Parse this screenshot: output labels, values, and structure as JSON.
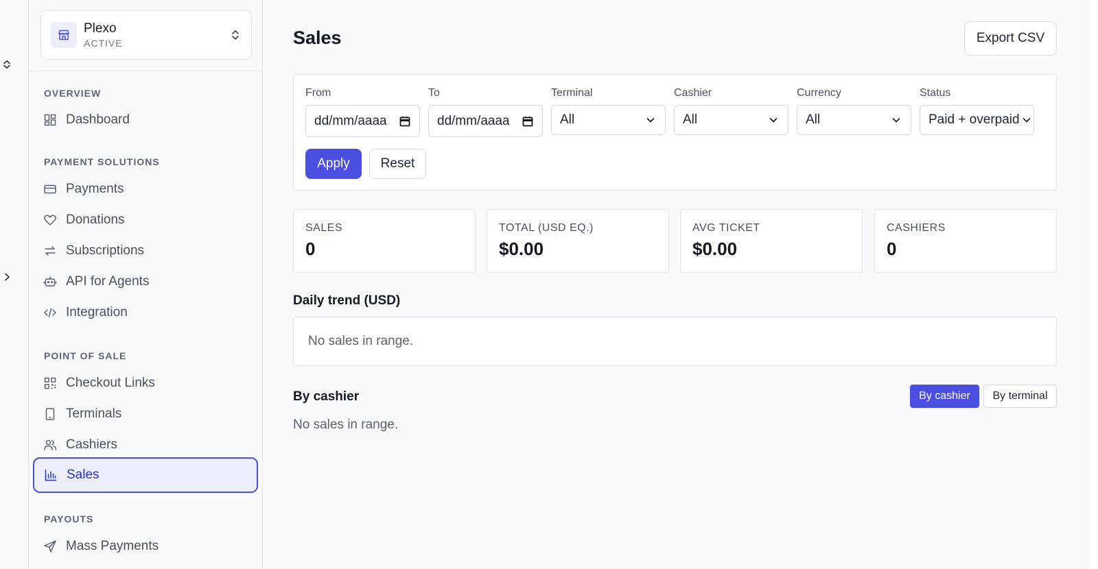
{
  "org": {
    "name": "Plexo",
    "status": "ACTIVE"
  },
  "nav": {
    "sections": [
      {
        "label": "OVERVIEW"
      },
      {
        "label": "PAYMENT SOLUTIONS"
      },
      {
        "label": "POINT OF SALE"
      },
      {
        "label": "PAYOUTS"
      }
    ],
    "items": {
      "dashboard": "Dashboard",
      "payments": "Payments",
      "donations": "Donations",
      "subscriptions": "Subscriptions",
      "api_agents": "API for Agents",
      "integration": "Integration",
      "checkout_links": "Checkout Links",
      "terminals": "Terminals",
      "cashiers": "Cashiers",
      "sales": "Sales",
      "mass_payments": "Mass Payments"
    },
    "active": "sales"
  },
  "page": {
    "title": "Sales",
    "export_label": "Export CSV"
  },
  "filters": {
    "from": {
      "label": "From",
      "value": "dd/mm/aaaa"
    },
    "to": {
      "label": "To",
      "value": "dd/mm/aaaa"
    },
    "terminal": {
      "label": "Terminal",
      "value": "All"
    },
    "cashier": {
      "label": "Cashier",
      "value": "All"
    },
    "currency": {
      "label": "Currency",
      "value": "All"
    },
    "status": {
      "label": "Status",
      "value": "Paid + overpaid"
    },
    "apply_label": "Apply",
    "reset_label": "Reset"
  },
  "kpis": [
    {
      "label": "SALES",
      "value": "0"
    },
    {
      "label": "TOTAL (USD EQ.)",
      "value": "$0.00"
    },
    {
      "label": "AVG TICKET",
      "value": "$0.00"
    },
    {
      "label": "CASHIERS",
      "value": "0"
    }
  ],
  "trend": {
    "title": "Daily trend (USD)",
    "empty": "No sales in range."
  },
  "breakdown": {
    "title": "By cashier",
    "toggle_on": "By cashier",
    "toggle_off": "By terminal",
    "empty": "No sales in range."
  }
}
